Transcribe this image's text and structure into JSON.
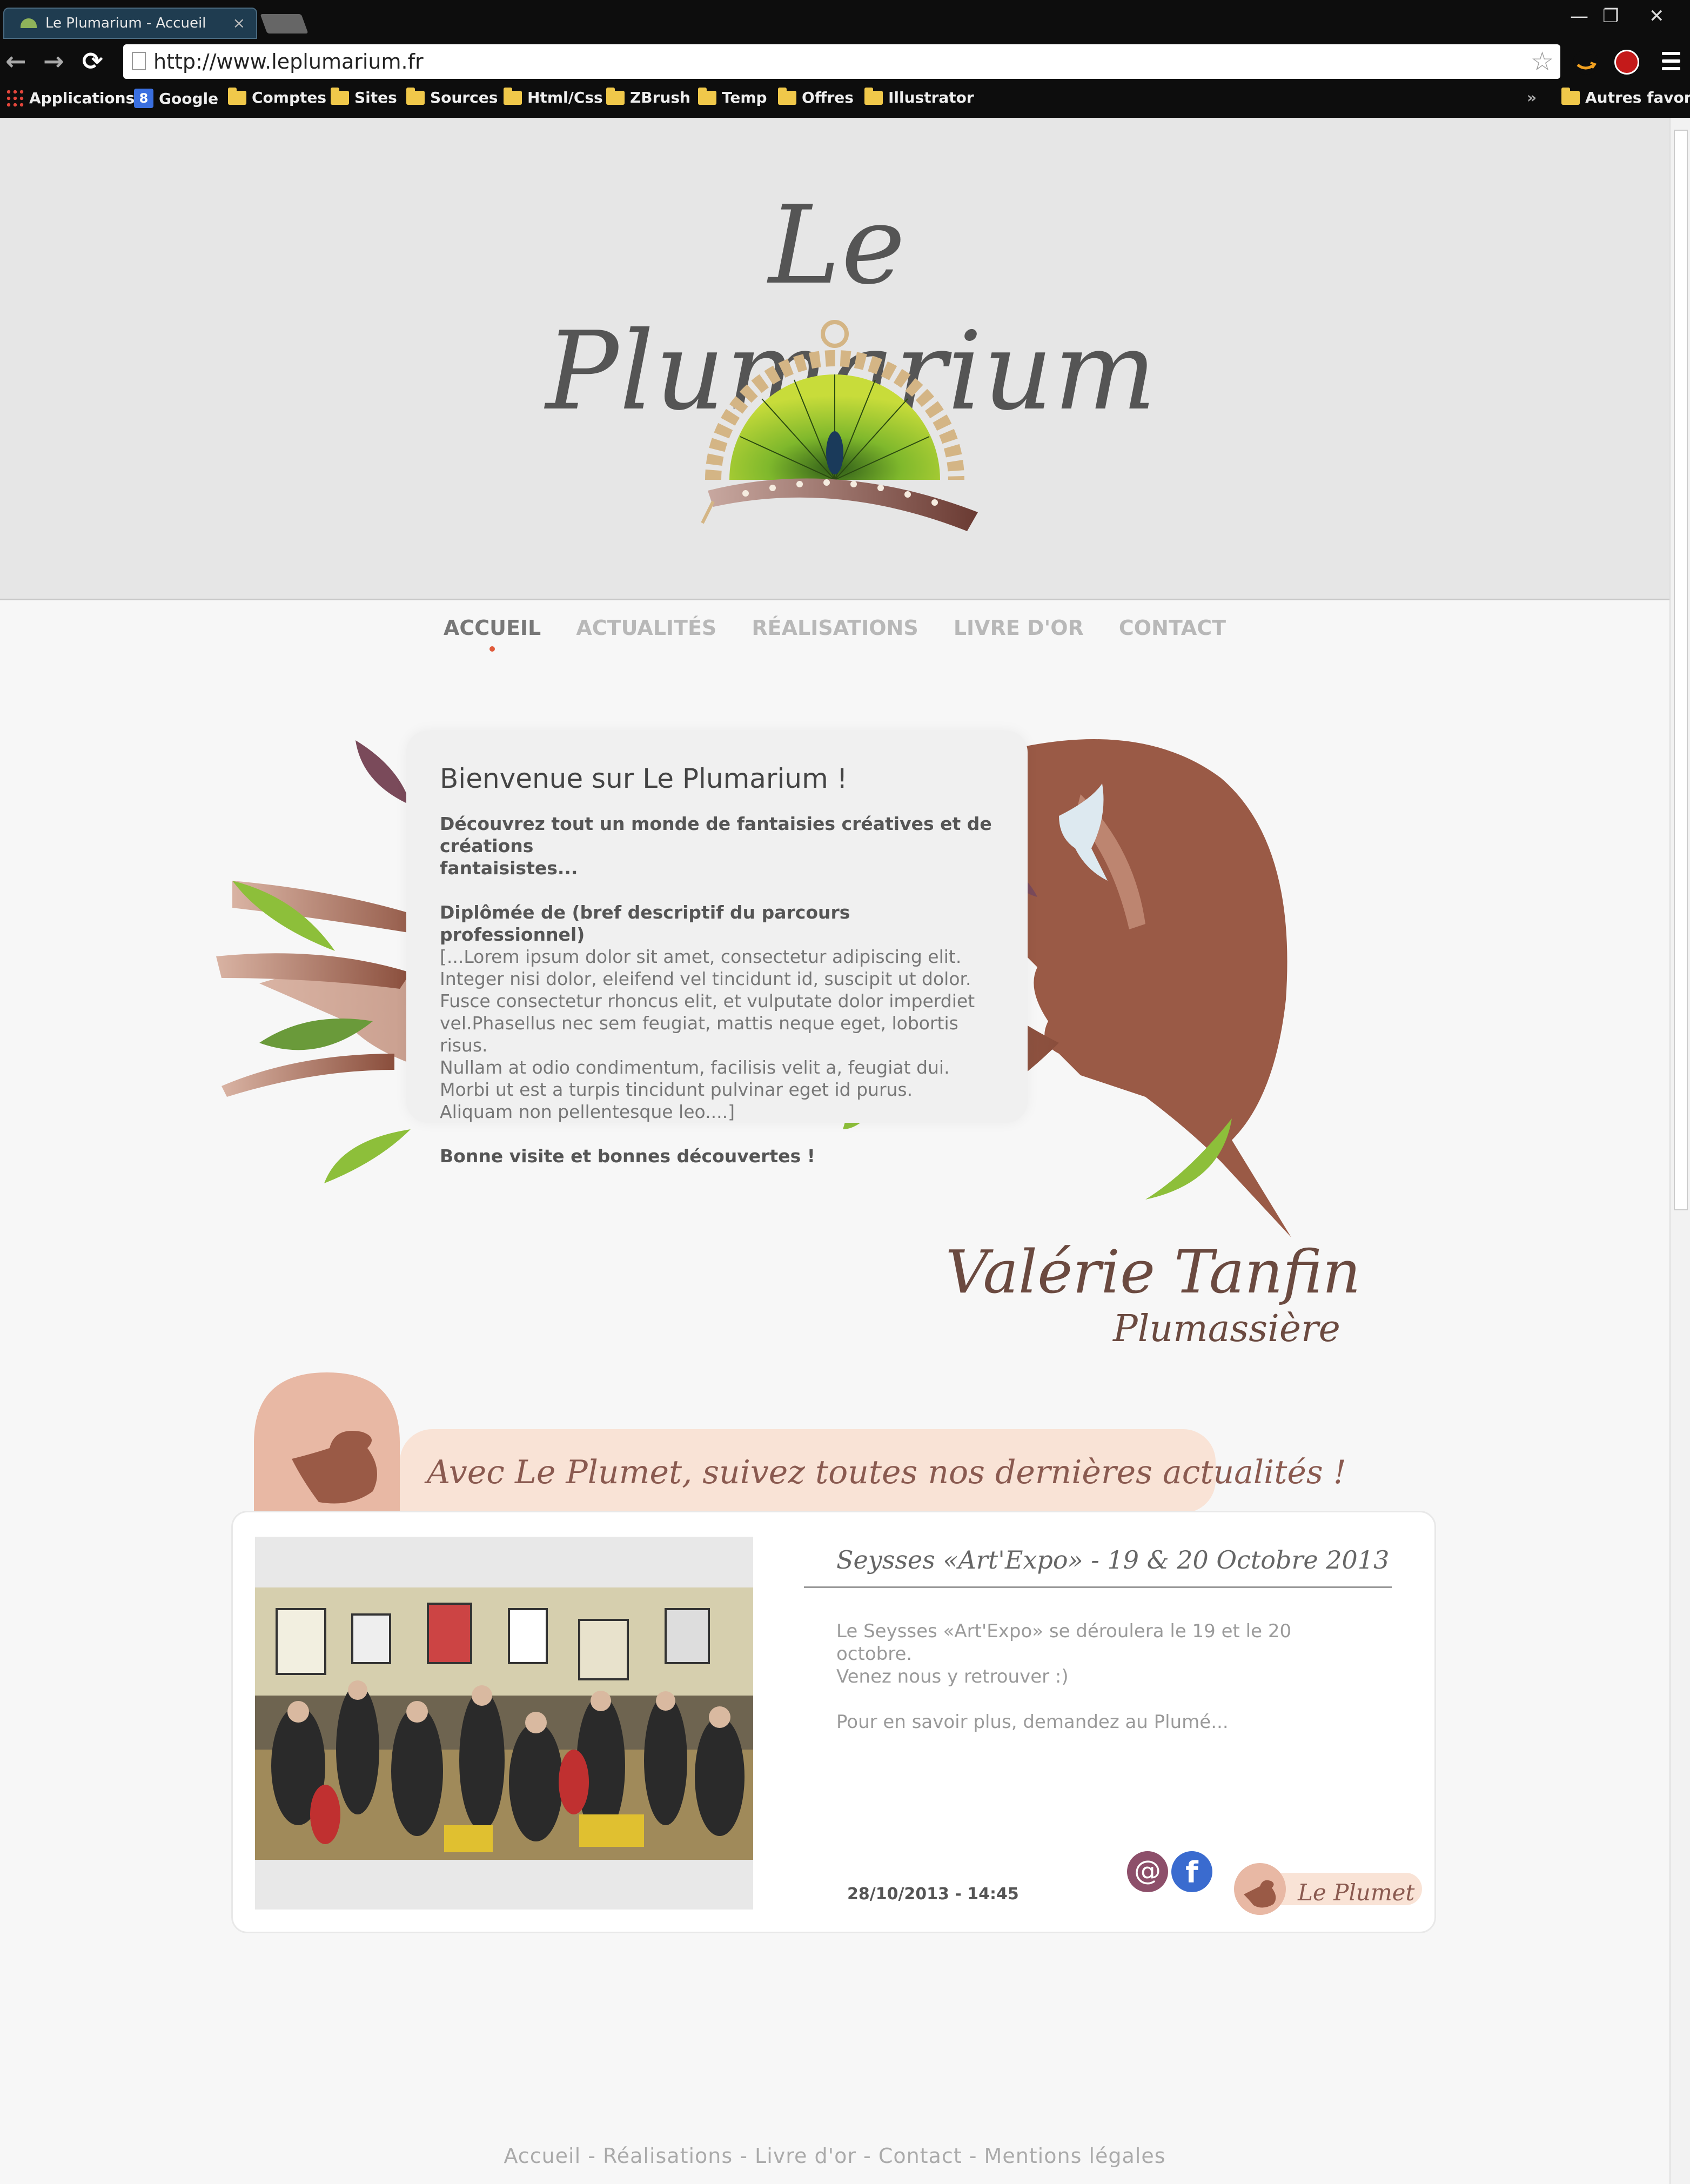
{
  "browser": {
    "tab_title": "Le Plumarium - Accueil",
    "tab_close": "×",
    "url": "http://www.leplumarium.fr",
    "window_controls": {
      "minimize": "—",
      "restore": "❐",
      "close": "✕"
    },
    "nav": {
      "back": "←",
      "forward": "→",
      "reload": "⟳"
    },
    "bookmarks": [
      {
        "label": "Applications",
        "icon": "apps-grid-icon"
      },
      {
        "label": "Google",
        "icon": "google-icon"
      },
      {
        "label": "Comptes",
        "icon": "folder-icon"
      },
      {
        "label": "Sites",
        "icon": "folder-icon"
      },
      {
        "label": "Sources",
        "icon": "folder-icon"
      },
      {
        "label": "Html/Css",
        "icon": "folder-icon"
      },
      {
        "label": "ZBrush",
        "icon": "folder-icon"
      },
      {
        "label": "Temp",
        "icon": "folder-icon"
      },
      {
        "label": "Offres",
        "icon": "folder-icon"
      },
      {
        "label": "Illustrator",
        "icon": "folder-icon"
      }
    ],
    "bookmarks_overflow": "»",
    "other_bookmarks": "Autres favoris"
  },
  "site": {
    "logo_text": "Le Plumarium",
    "menu": [
      {
        "label": "ACCUEIL",
        "active": true
      },
      {
        "label": "ACTUALITÉS",
        "active": false
      },
      {
        "label": "RÉALISATIONS",
        "active": false
      },
      {
        "label": "LIVRE D'OR",
        "active": false
      },
      {
        "label": "CONTACT",
        "active": false
      }
    ],
    "welcome": {
      "title": "Bienvenue sur Le Plumarium !",
      "intro_1": "Découvrez tout un monde de fantaisies créatives et de créations",
      "intro_2": "fantaisistes...",
      "lines": [
        "Diplômée de (bref descriptif du parcours professionnel)",
        "[...Lorem ipsum dolor sit amet, consectetur adipiscing elit.",
        "Integer nisi dolor, eleifend vel tincidunt id, suscipit ut dolor.",
        "Fusce consectetur rhoncus elit, et vulputate dolor imperdiet",
        "vel.Phasellus nec sem feugiat, mattis neque eget, lobortis risus.",
        "Nullam at odio condimentum, facilisis velit a, feugiat dui.",
        "Morbi ut est a turpis tincidunt pulvinar eget id purus.",
        "Aliquam non pellentesque leo....]"
      ],
      "closing": "Bonne visite et bonnes découvertes !"
    },
    "signature_name": "Valérie Tanfin",
    "signature_title": "Plumassière",
    "news_banner": "Avec Le Plumet, suivez toutes nos dernières actualités !",
    "news": {
      "title": "Seysses «Art'Expo» - 19 & 20 Octobre 2013",
      "body_1": "Le Seysses «Art'Expo» se déroulera le 19 et le 20 octobre.",
      "body_2": "Venez nous y retrouver :)",
      "body_3": "Pour en savoir plus, demandez au Plumé...",
      "date": "28/10/2013 - 14:45",
      "share_mail": "@",
      "share_facebook": "f",
      "tag": "Le Plumet"
    },
    "footer": "Accueil - Réalisations - Livre d'or - Contact - Mentions légales"
  },
  "colors": {
    "accent_brown": "#8a5a4a",
    "feather_green": "#8dbf3a",
    "nav_active_dot": "#e05a3a",
    "banner_peach": "#f9e3d6"
  }
}
